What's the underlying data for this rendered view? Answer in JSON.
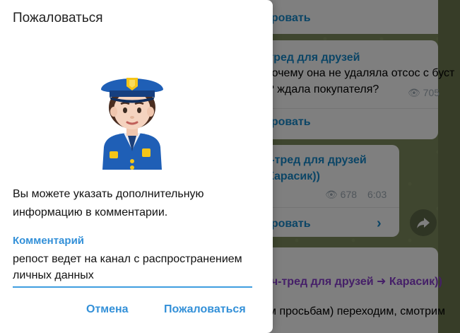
{
  "dialog": {
    "title": "Пожаловаться",
    "description": "Вы можете указать дополнительную информацию в комментарии.",
    "comment_label": "Комментарий",
    "comment_value": "репост ведет на канал с распространением личных данных",
    "cancel_label": "Отмена",
    "report_label": "Пожаловаться",
    "illustration_icon": "police-officer-emoji"
  },
  "background_chat": {
    "msg1": {
      "forward_label": "ировать"
    },
    "msg2": {
      "channel": "-тред для друзей",
      "line1": "почему она не удаляла отсос с буст",
      "line2": "и? ждала покупателя?",
      "views": "705",
      "forward_label": "ировать"
    },
    "msg3": {
      "channel": "ч-тред для друзей",
      "line1": "Карасик))",
      "views": "678",
      "time": "6:03",
      "forward_label": "ировать"
    },
    "msg4": {
      "channel_prefix": "ич-тред для друзей",
      "channel_suffix": "Карасик))",
      "line1": "м просьбам) переходим, смотрим"
    }
  },
  "colors": {
    "accent": "#3390d8",
    "dialog_bg": "#ffffff",
    "overlay": "rgba(0,0,0,0.5)"
  }
}
